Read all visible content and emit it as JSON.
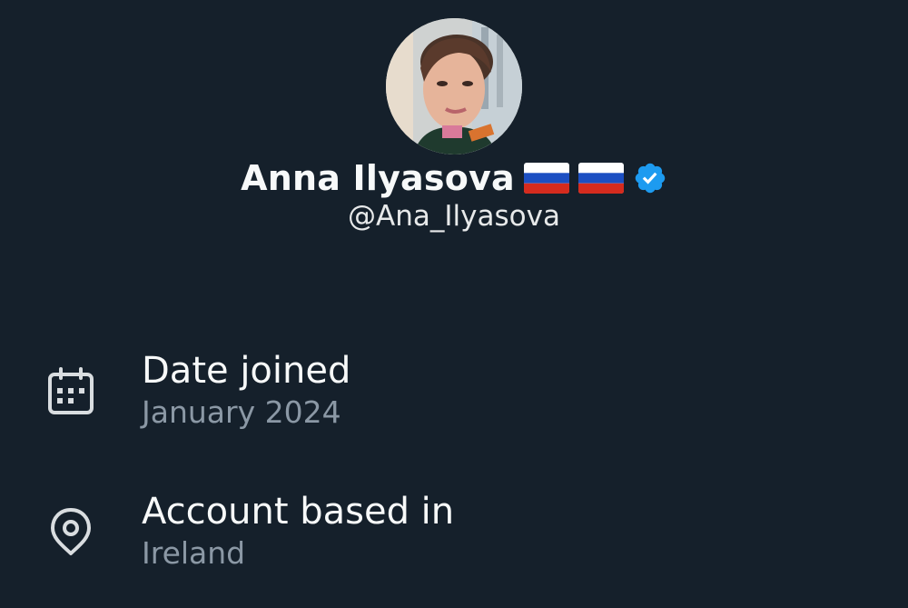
{
  "profile": {
    "display_name": "Anna Ilyasova",
    "flags": [
      "russia-flag",
      "russia-flag"
    ],
    "verified_icon": "verified-badge-icon",
    "handle": "@Ana_Ilyasova",
    "avatar": "profile-avatar"
  },
  "about": {
    "items": [
      {
        "icon": "calendar-icon",
        "title": "Date joined",
        "value": "January 2024"
      },
      {
        "icon": "location-pin-icon",
        "title": "Account based in",
        "value": "Ireland"
      }
    ]
  },
  "colors": {
    "background": "#15202b",
    "primary_text": "#f7f9f9",
    "secondary_text": "#8b98a5",
    "verified_blue": "#1d9bf0"
  }
}
